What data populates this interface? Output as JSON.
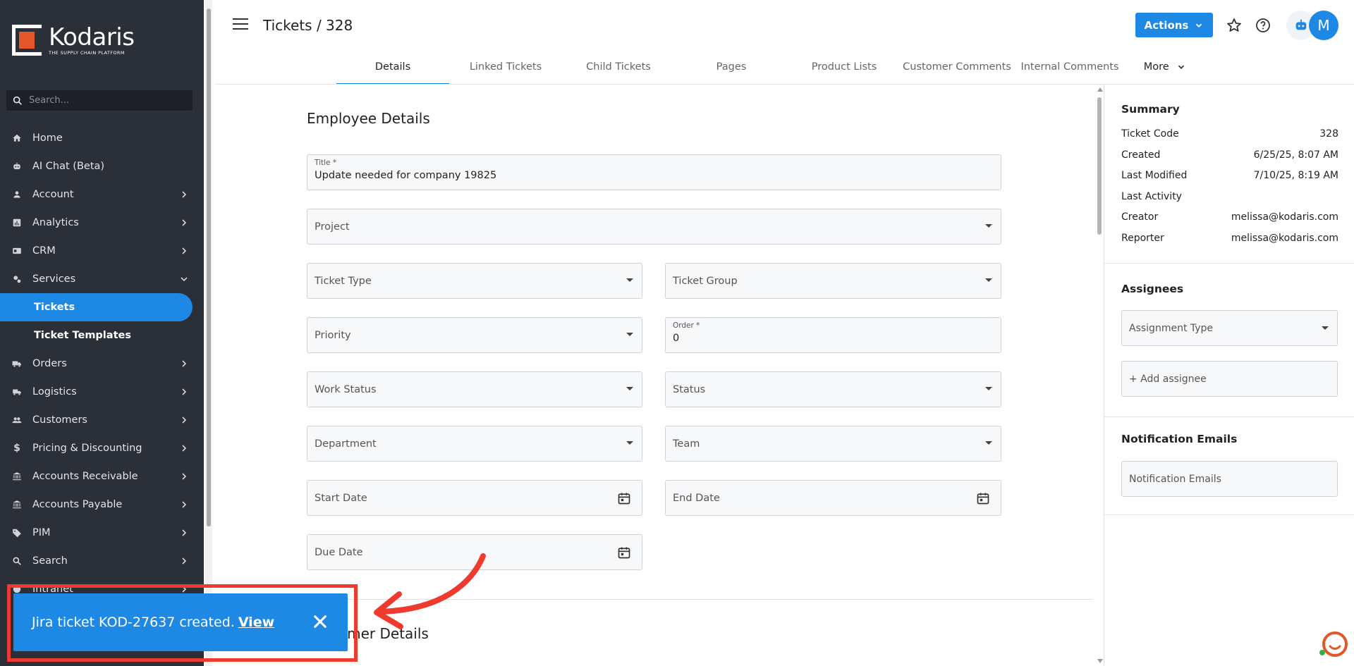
{
  "brand": {
    "name": "Kodaris",
    "tagline": "THE SUPPLY CHAIN PLATFORM"
  },
  "sidebar": {
    "search_placeholder": "Search...",
    "items": [
      {
        "label": "Home",
        "icon": "home-icon",
        "chevron": false
      },
      {
        "label": "AI Chat (Beta)",
        "icon": "robot-icon",
        "chevron": false
      },
      {
        "label": "Account",
        "icon": "person-icon",
        "chevron": "right"
      },
      {
        "label": "Analytics",
        "icon": "analytics-icon",
        "chevron": "right"
      },
      {
        "label": "CRM",
        "icon": "crm-icon",
        "chevron": "right"
      },
      {
        "label": "Services",
        "icon": "services-icon",
        "chevron": "down"
      },
      {
        "label": "Tickets",
        "sub": true,
        "active": true
      },
      {
        "label": "Ticket Templates",
        "sub": true
      },
      {
        "label": "Orders",
        "icon": "truck-icon",
        "chevron": "right"
      },
      {
        "label": "Logistics",
        "icon": "logistics-icon",
        "chevron": "right"
      },
      {
        "label": "Customers",
        "icon": "people-icon",
        "chevron": "right"
      },
      {
        "label": "Pricing & Discounting",
        "icon": "dollar-icon",
        "chevron": "right"
      },
      {
        "label": "Accounts Receivable",
        "icon": "bank-icon",
        "chevron": "right"
      },
      {
        "label": "Accounts Payable",
        "icon": "bank-icon",
        "chevron": "right"
      },
      {
        "label": "PIM",
        "icon": "tag-icon",
        "chevron": "right"
      },
      {
        "label": "Search",
        "icon": "search-icon",
        "chevron": "right"
      },
      {
        "label": "Intranet",
        "icon": "intranet-icon",
        "chevron": "right"
      }
    ]
  },
  "header": {
    "title": "Tickets / 328",
    "actions_label": "Actions",
    "avatar_initial": "M",
    "tabs": [
      "Details",
      "Linked Tickets",
      "Child Tickets",
      "Pages",
      "Product Lists",
      "Customer Comments",
      "Internal Comments"
    ],
    "more_label": "More"
  },
  "form": {
    "section_title": "Employee Details",
    "next_section_title": "Customer Details",
    "title_label": "Title *",
    "title_value": "Update needed for company 19825",
    "project": "Project",
    "ticket_type": "Ticket Type",
    "ticket_group": "Ticket Group",
    "priority": "Priority",
    "order_label": "Order *",
    "order_value": "0",
    "work_status": "Work Status",
    "status": "Status",
    "department": "Department",
    "team": "Team",
    "start_date": "Start Date",
    "end_date": "End Date",
    "due_date": "Due Date"
  },
  "summary": {
    "title": "Summary",
    "rows": [
      {
        "key": "Ticket Code",
        "value": "328"
      },
      {
        "key": "Created",
        "value": "6/25/25, 8:07 AM"
      },
      {
        "key": "Last Modified",
        "value": "7/10/25, 8:19 AM"
      },
      {
        "key": "Last Activity",
        "value": ""
      },
      {
        "key": "Creator",
        "value": "melissa@kodaris.com"
      },
      {
        "key": "Reporter",
        "value": "melissa@kodaris.com"
      }
    ]
  },
  "assignees": {
    "title": "Assignees",
    "type_label": "Assignment Type",
    "add_label": "+ Add assignee"
  },
  "notifications": {
    "title": "Notification Emails",
    "field_label": "Notification Emails"
  },
  "toast": {
    "message": "Jira ticket KOD-27637 created.",
    "link": "View"
  },
  "colors": {
    "primary": "#1e88e5",
    "sidebar": "#2b2f38",
    "highlight": "#ef3b2d",
    "brand_orange": "#e3572b"
  }
}
